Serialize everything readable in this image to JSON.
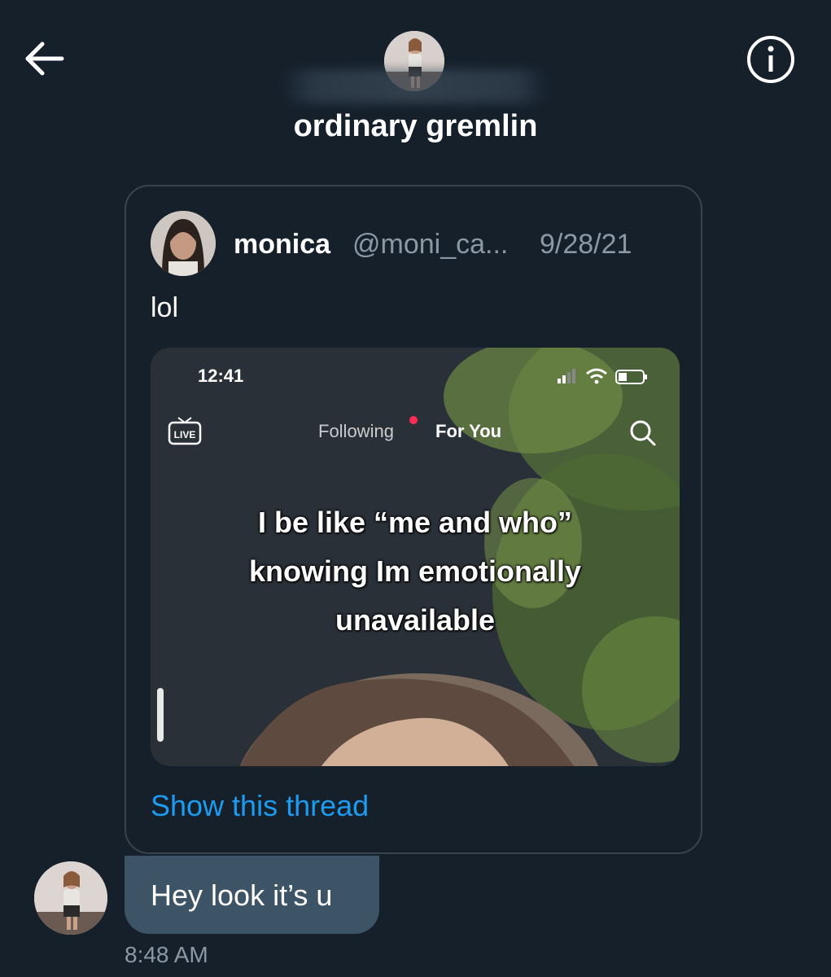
{
  "header": {
    "avatar_alt": "ordinary gremlin profile photo",
    "conversation_name": "ordinary gremlin",
    "back_icon": "arrow-left-icon",
    "info_icon": "info-circle-icon"
  },
  "quoted_tweet": {
    "author_name": "monica",
    "author_handle": "@moni_ca...",
    "date": "9/28/21",
    "text": "lol",
    "media": {
      "status_time": "12:41",
      "tab_following": "Following",
      "tab_for_you": "For You",
      "live_label": "LIVE",
      "caption_lines": [
        "I be like “me and who”",
        "knowing Im emotionally",
        "unavailable"
      ]
    },
    "show_thread_label": "Show this thread"
  },
  "message": {
    "text": "Hey look it’s u",
    "timestamp": "8:48 AM"
  },
  "colors": {
    "background": "#15202b",
    "bubble": "#3d5466",
    "link": "#1d9bf0",
    "muted": "#8b98a5",
    "border": "#38444d"
  }
}
